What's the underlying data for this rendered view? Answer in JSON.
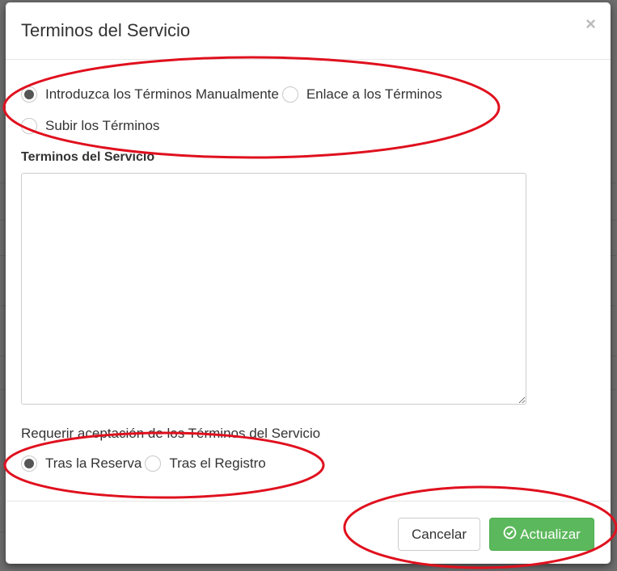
{
  "modal": {
    "title": "Terminos del Servicio",
    "close_glyph": "×"
  },
  "terms_source": {
    "options": [
      {
        "label": "Introduzca los Términos Manualmente",
        "checked": true
      },
      {
        "label": "Enlace a los Términos",
        "checked": false
      },
      {
        "label": "Subir los Términos",
        "checked": false
      }
    ]
  },
  "terms_field": {
    "label": "Terminos del Servicio",
    "value": ""
  },
  "acceptance": {
    "label": "Requerir aceptación de los Términos del Servicio",
    "options": [
      {
        "label": "Tras la Reserva",
        "checked": true
      },
      {
        "label": "Tras el Registro",
        "checked": false
      }
    ]
  },
  "footer": {
    "cancel_label": "Cancelar",
    "update_label": "Actualizar",
    "update_icon": "check-circle-icon"
  },
  "colors": {
    "primary_success": "#5cb85c",
    "annotation_red": "#e0101e"
  }
}
